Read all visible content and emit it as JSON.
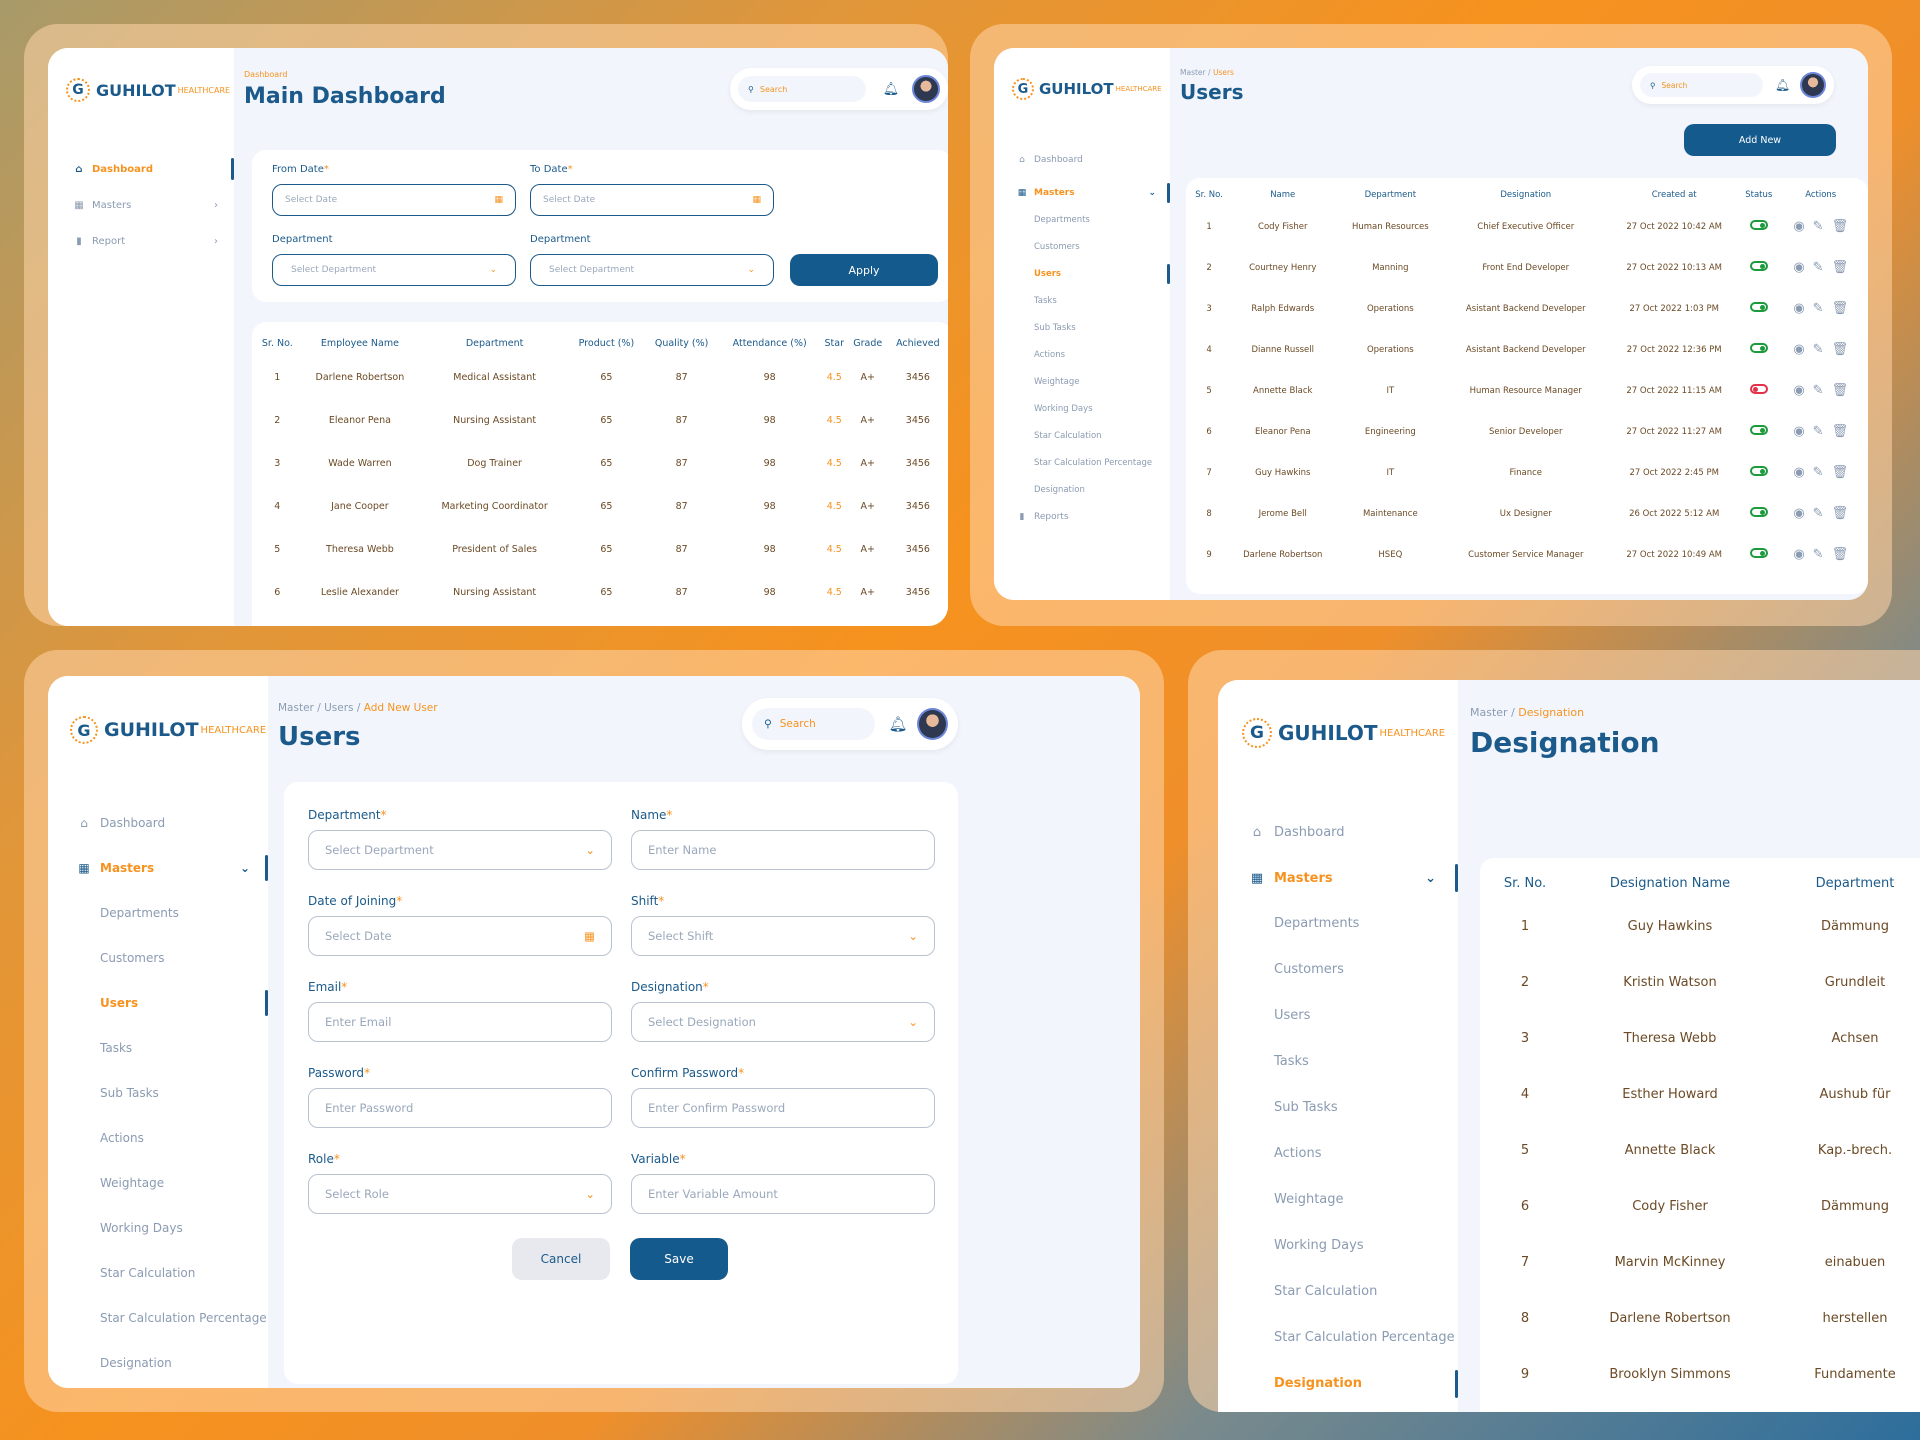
{
  "brand": {
    "name": "GUHILOT",
    "suffix": "HEALTHCARE",
    "logo_letter": "G"
  },
  "search_placeholder": "Search",
  "dashboard": {
    "breadcrumb": "Dashboard",
    "title": "Main Dashboard",
    "sidebar": [
      {
        "label": "Dashboard",
        "icon": "home-icon"
      },
      {
        "label": "Masters",
        "icon": "grid-icon"
      },
      {
        "label": "Report",
        "icon": "chart-icon"
      }
    ],
    "filters": {
      "from_label": "From Date",
      "to_label": "To Date",
      "date_placeholder": "Select Date",
      "dept_label": "Department",
      "dept_placeholder": "Select Department",
      "apply": "Apply"
    },
    "columns": [
      "Sr. No.",
      "Employee Name",
      "Department",
      "Product (%)",
      "Quality (%)",
      "Attendance (%)",
      "Star",
      "Grade",
      "Achieved"
    ],
    "rows": [
      [
        "1",
        "Darlene Robertson",
        "Medical Assistant",
        "65",
        "87",
        "98",
        "4.5",
        "A+",
        "3456"
      ],
      [
        "2",
        "Eleanor Pena",
        "Nursing Assistant",
        "65",
        "87",
        "98",
        "4.5",
        "A+",
        "3456"
      ],
      [
        "3",
        "Wade Warren",
        "Dog Trainer",
        "65",
        "87",
        "98",
        "4.5",
        "A+",
        "3456"
      ],
      [
        "4",
        "Jane Cooper",
        "Marketing Coordinator",
        "65",
        "87",
        "98",
        "4.5",
        "A+",
        "3456"
      ],
      [
        "5",
        "Theresa Webb",
        "President of Sales",
        "65",
        "87",
        "98",
        "4.5",
        "A+",
        "3456"
      ],
      [
        "6",
        "Leslie Alexander",
        "Nursing Assistant",
        "65",
        "87",
        "98",
        "4.5",
        "A+",
        "3456"
      ]
    ]
  },
  "users": {
    "breadcrumb_root": "Master",
    "breadcrumb_sep": "/",
    "breadcrumb_cur": "Users",
    "title": "Users",
    "add_new": "Add New",
    "sidebar_top": [
      {
        "label": "Dashboard",
        "icon": "home-icon"
      },
      {
        "label": "Masters",
        "icon": "grid-icon"
      }
    ],
    "sub_items": [
      "Departments",
      "Customers",
      "Users",
      "Tasks",
      "Sub Tasks",
      "Actions",
      "Weightage",
      "Working Days",
      "Star Calculation",
      "Star Calculation Percentage",
      "Designation"
    ],
    "reports": "Reports",
    "columns": [
      "Sr. No.",
      "Name",
      "Department",
      "Designation",
      "Created at",
      "Status",
      "Actions"
    ],
    "rows": [
      [
        "1",
        "Cody Fisher",
        "Human Resources",
        "Chief Executive Officer",
        "27 Oct 2022 10:42 AM",
        "on"
      ],
      [
        "2",
        "Courtney Henry",
        "Manning",
        "Front End Developer",
        "27 Oct 2022 10:13 AM",
        "on"
      ],
      [
        "3",
        "Ralph Edwards",
        "Operations",
        "Asistant Backend Developer",
        "27 Oct 2022 1:03 PM",
        "on"
      ],
      [
        "4",
        "Dianne Russell",
        "Operations",
        "Asistant Backend Developer",
        "27 Oct 2022 12:36 PM",
        "on"
      ],
      [
        "5",
        "Annette Black",
        "IT",
        "Human Resource Manager",
        "27 Oct 2022 11:15 AM",
        "off"
      ],
      [
        "6",
        "Eleanor Pena",
        "Engineering",
        "Senior Developer",
        "27 Oct 2022 11:27 AM",
        "on"
      ],
      [
        "7",
        "Guy Hawkins",
        "IT",
        "Finance",
        "27 Oct 2022 2:45 PM",
        "on"
      ],
      [
        "8",
        "Jerome Bell",
        "Maintenance",
        "Ux Designer",
        "26 Oct 2022 5:12 AM",
        "on"
      ],
      [
        "9",
        "Darlene Robertson",
        "HSEQ",
        "Customer Service Manager",
        "27 Oct 2022 10:49 AM",
        "on"
      ]
    ]
  },
  "add_user": {
    "breadcrumb_root": "Master",
    "breadcrumb_mid": "Users",
    "breadcrumb_cur": "Add New User",
    "sep": "/",
    "title": "Users",
    "sidebar_top": [
      {
        "label": "Dashboard"
      },
      {
        "label": "Masters"
      }
    ],
    "sub_items": [
      "Departments",
      "Customers",
      "Users",
      "Tasks",
      "Sub Tasks",
      "Actions",
      "Weightage",
      "Working Days",
      "Star Calculation",
      "Star Calculation Percentage",
      "Designation"
    ],
    "fields": {
      "department": {
        "label": "Department",
        "placeholder": "Select Department"
      },
      "name": {
        "label": "Name",
        "placeholder": "Enter Name"
      },
      "doj": {
        "label": "Date of Joining",
        "placeholder": "Select Date"
      },
      "shift": {
        "label": "Shift",
        "placeholder": "Select Shift"
      },
      "email": {
        "label": "Email",
        "placeholder": "Enter Email"
      },
      "designation": {
        "label": "Designation",
        "placeholder": "Select Designation"
      },
      "password": {
        "label": "Password",
        "placeholder": "Enter Password"
      },
      "confirm": {
        "label": "Confirm Password",
        "placeholder": "Enter Confirm Password"
      },
      "role": {
        "label": "Role",
        "placeholder": "Select Role"
      },
      "variable": {
        "label": "Variable",
        "placeholder": "Enter Variable Amount"
      }
    },
    "required_mark": "*",
    "cancel": "Cancel",
    "save": "Save"
  },
  "designation": {
    "breadcrumb_root": "Master",
    "sep": "/",
    "breadcrumb_cur": "Designation",
    "title": "Designation",
    "sidebar_top": [
      {
        "label": "Dashboard"
      },
      {
        "label": "Masters"
      }
    ],
    "sub_items": [
      "Departments",
      "Customers",
      "Users",
      "Tasks",
      "Sub Tasks",
      "Actions",
      "Weightage",
      "Working Days",
      "Star Calculation",
      "Star Calculation Percentage",
      "Designation"
    ],
    "columns": [
      "Sr. No.",
      "Designation Name",
      "Department"
    ],
    "rows": [
      [
        "1",
        "Guy Hawkins",
        "Dämmung"
      ],
      [
        "2",
        "Kristin Watson",
        "Grundleit"
      ],
      [
        "3",
        "Theresa Webb",
        "Achsen"
      ],
      [
        "4",
        "Esther Howard",
        "Aushub für"
      ],
      [
        "5",
        "Annette Black",
        "Kap.-brech."
      ],
      [
        "6",
        "Cody Fisher",
        "Dämmung"
      ],
      [
        "7",
        "Marvin McKinney",
        "einabuen"
      ],
      [
        "8",
        "Darlene Robertson",
        "herstellen"
      ],
      [
        "9",
        "Brooklyn Simmons",
        "Fundamente"
      ]
    ]
  }
}
